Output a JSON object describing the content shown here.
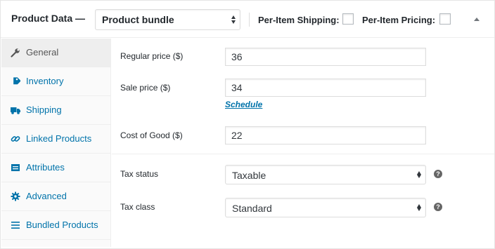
{
  "header": {
    "title": "Product Data —",
    "product_type": "Product bundle",
    "per_item_shipping_label": "Per-Item Shipping:",
    "per_item_pricing_label": "Per-Item Pricing:",
    "per_item_shipping_checked": false,
    "per_item_pricing_checked": false
  },
  "tabs": [
    {
      "label": "General",
      "icon": "wrench-icon",
      "active": true
    },
    {
      "label": "Inventory",
      "icon": "tag-icon",
      "active": false
    },
    {
      "label": "Shipping",
      "icon": "truck-icon",
      "active": false
    },
    {
      "label": "Linked Products",
      "icon": "link-icon",
      "active": false
    },
    {
      "label": "Attributes",
      "icon": "table-icon",
      "active": false
    },
    {
      "label": "Advanced",
      "icon": "gear-icon",
      "active": false
    },
    {
      "label": "Bundled Products",
      "icon": "list-icon",
      "active": false
    }
  ],
  "general": {
    "regular_price_label": "Regular price ($)",
    "regular_price": "36",
    "sale_price_label": "Sale price ($)",
    "sale_price": "34",
    "schedule_link": "Schedule",
    "cost_of_good_label": "Cost of Good ($)",
    "cost_of_good": "22",
    "tax_status_label": "Tax status",
    "tax_status": "Taxable",
    "tax_class_label": "Tax class",
    "tax_class": "Standard"
  },
  "colors": {
    "link": "#0073aa",
    "active_tab_bg": "#eeeeee",
    "tab_bar_bg": "#fafafa"
  }
}
